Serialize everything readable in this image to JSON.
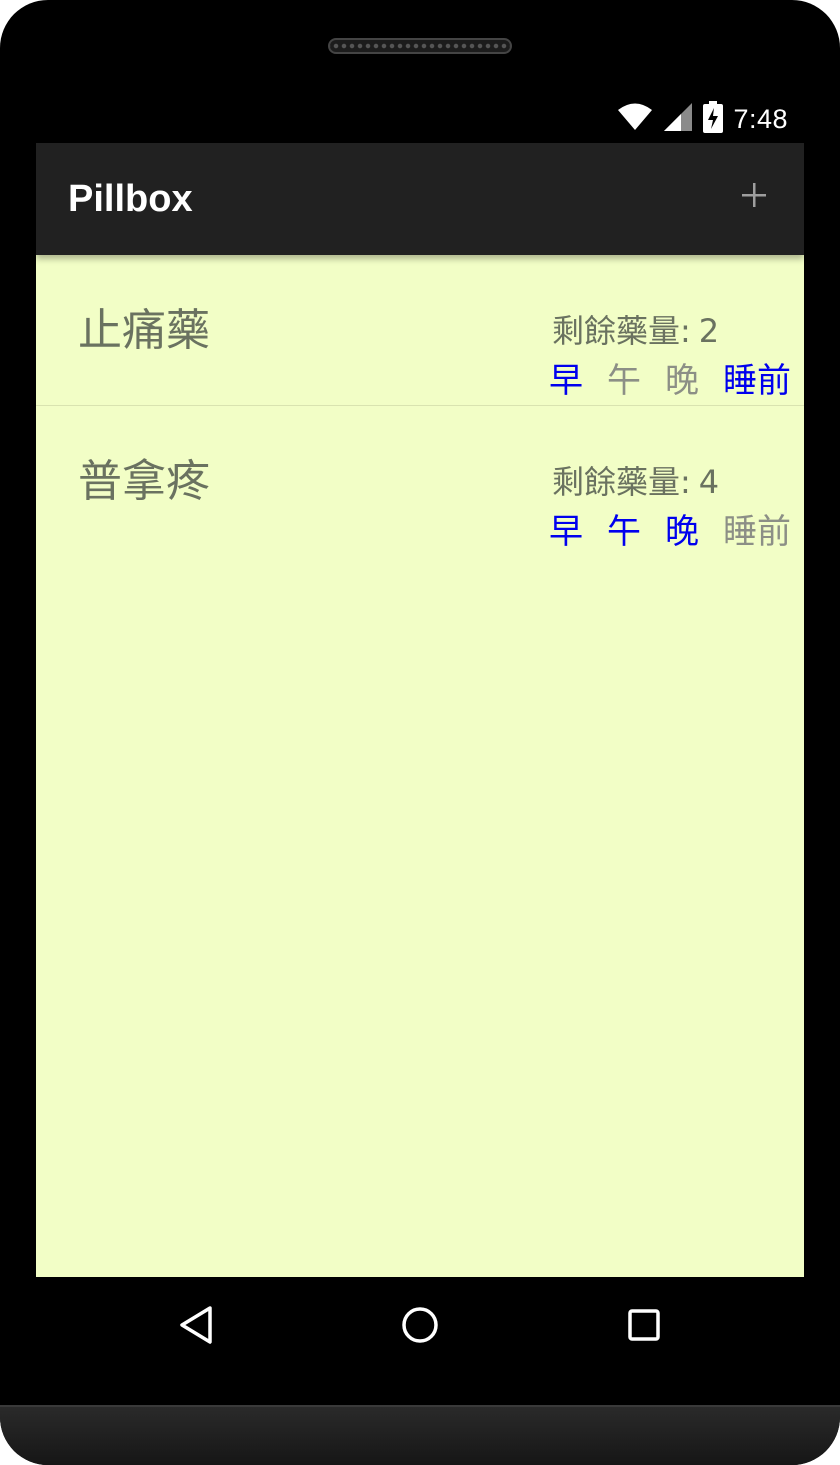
{
  "status_bar": {
    "time": "7:48",
    "icons": [
      "wifi-icon",
      "signal-icon",
      "battery-charging-icon"
    ]
  },
  "app_bar": {
    "title": "Pillbox",
    "add_icon": "plus-icon"
  },
  "medications": [
    {
      "name": "止痛藥",
      "remaining_label": "剩餘藥量:",
      "remaining_count": "2",
      "slots": [
        {
          "label": "早",
          "active": true
        },
        {
          "label": "午",
          "active": false
        },
        {
          "label": "晚",
          "active": false
        },
        {
          "label": "睡前",
          "active": true
        }
      ]
    },
    {
      "name": "普拿疼",
      "remaining_label": "剩餘藥量:",
      "remaining_count": "4",
      "slots": [
        {
          "label": "早",
          "active": true
        },
        {
          "label": "午",
          "active": true
        },
        {
          "label": "晚",
          "active": true
        },
        {
          "label": "睡前",
          "active": false
        }
      ]
    }
  ],
  "nav_bar": {
    "icons": [
      "back-icon",
      "home-icon",
      "recents-icon"
    ]
  },
  "colors": {
    "screen_background": "#f2fec6",
    "app_bar": "#212121",
    "slot_active": "#0000ee",
    "slot_inactive": "#8c8f86",
    "text_muted": "#6a7260"
  }
}
